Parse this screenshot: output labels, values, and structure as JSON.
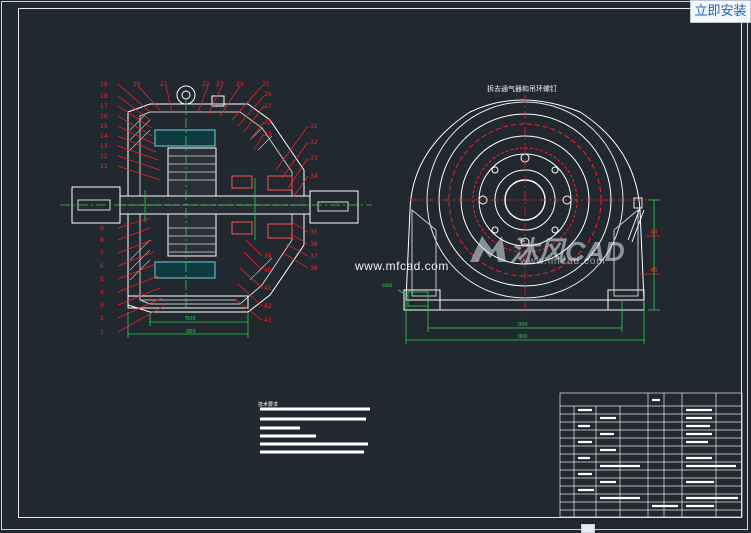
{
  "install_button": {
    "label": "立即安装"
  },
  "watermark": {
    "url_text": "www.mfcad.com",
    "logo_text": "沐风CAD",
    "logo_url": "www.mfcad.com"
  },
  "drawing": {
    "view_title": "拆去通气器和吊环螺钉",
    "part_numbers_left": [
      "19",
      "18",
      "17",
      "16",
      "15",
      "14",
      "13",
      "12",
      "11",
      "10",
      "9",
      "8",
      "7",
      "6",
      "5",
      "4",
      "3",
      "2",
      "1"
    ],
    "part_numbers_top": [
      "20",
      "21",
      "22",
      "23",
      "24",
      "25",
      "26",
      "27",
      "28",
      "29"
    ],
    "part_numbers_right": [
      "31",
      "32",
      "33",
      "34",
      "35",
      "36",
      "37",
      "38",
      "39",
      "40",
      "41",
      "42",
      "43"
    ],
    "notes_title": "技术要求",
    "colors": {
      "background": "#212830",
      "outline": "#ffffff",
      "leader": "#ff2020",
      "dimension": "#2bd34a",
      "hidden": "#b8b8b8"
    }
  }
}
